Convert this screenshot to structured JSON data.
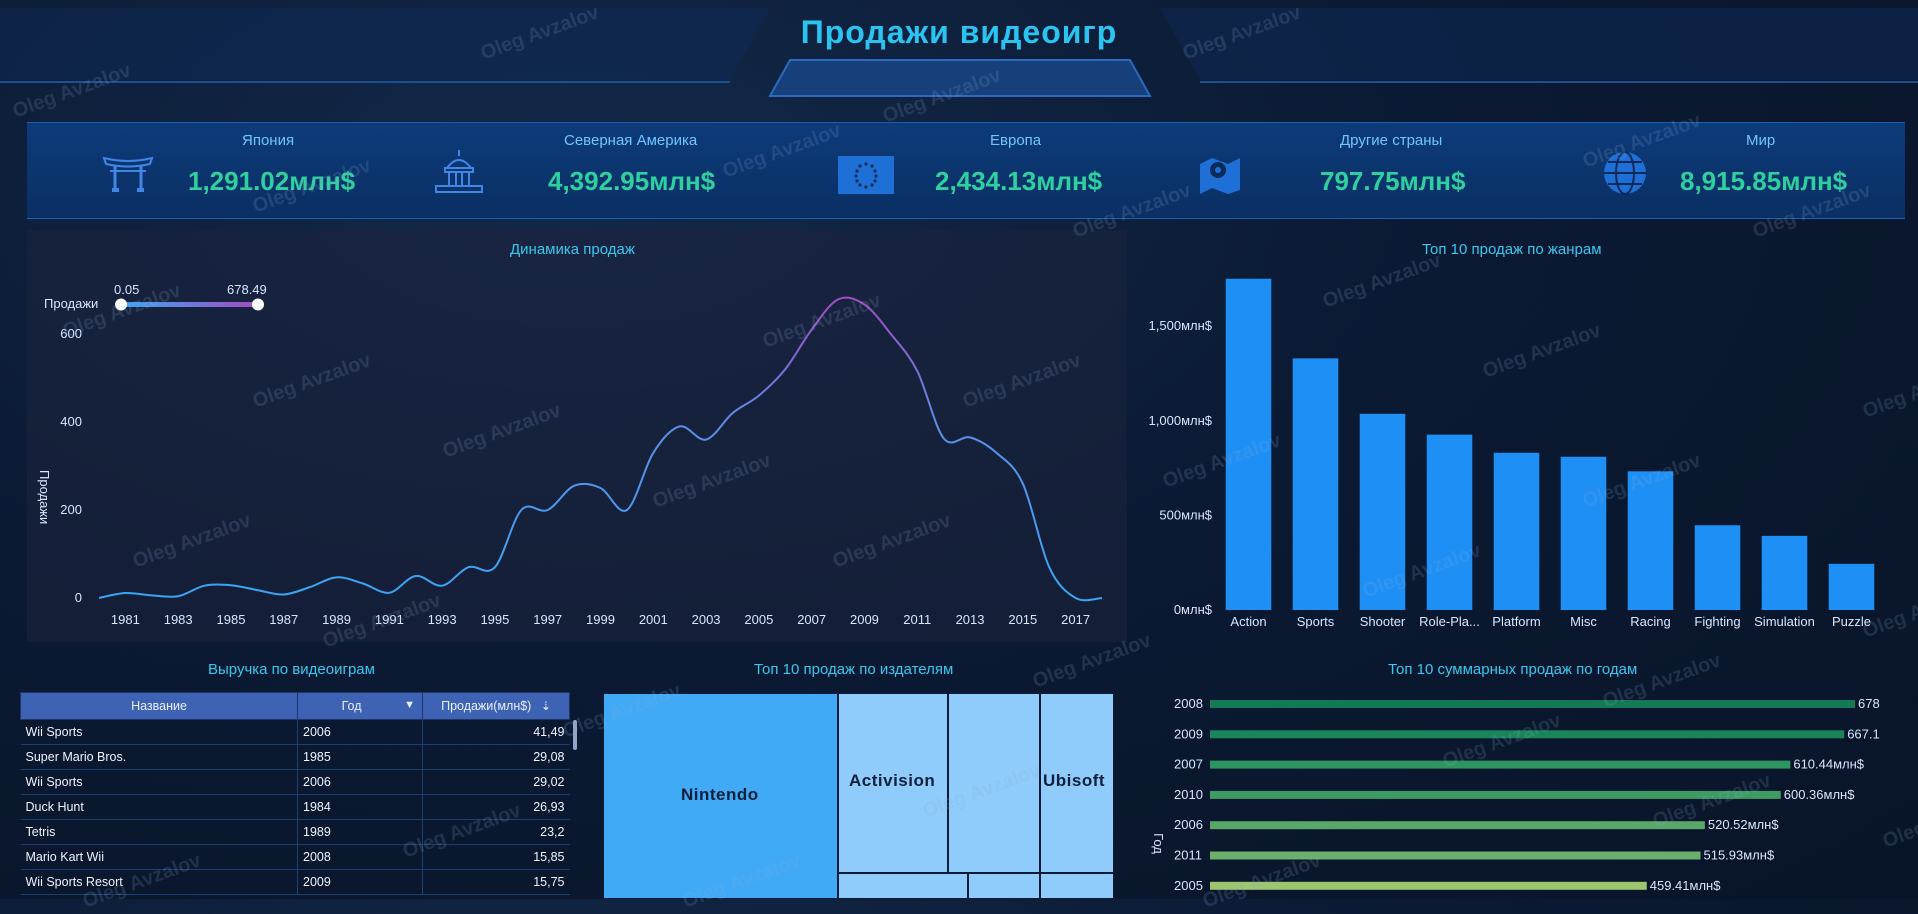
{
  "page_title": "Продажи видеоигр",
  "watermark": "Oleg Avzalov",
  "kpis": [
    {
      "label": "Япония",
      "value": "1,291.02млн$",
      "icon": "torii-gate-icon"
    },
    {
      "label": "Северная Америка",
      "value": "4,392.95млн$",
      "icon": "capitol-icon"
    },
    {
      "label": "Европа",
      "value": "2,434.13млн$",
      "icon": "eu-flag-icon"
    },
    {
      "label": "Другие страны",
      "value": "797.75млн$",
      "icon": "map-pin-icon"
    },
    {
      "label": "Мир",
      "value": "8,915.85млн$",
      "icon": "globe-icon"
    }
  ],
  "colors": {
    "accent": "#29c5f0",
    "kpi_value": "#2fd0a0",
    "bar": "#1e8ff5",
    "line_start": "#3aa6f5",
    "line_peak": "#a24cbf"
  },
  "chart_data": [
    {
      "type": "line",
      "title": "Динамика продаж",
      "ylabel": "Продажи",
      "legend_label": "Продажи",
      "range_min": "0.05",
      "range_max": "678.49",
      "x_ticks": [
        1981,
        1983,
        1985,
        1987,
        1989,
        1991,
        1993,
        1995,
        1997,
        1999,
        2001,
        2003,
        2005,
        2007,
        2009,
        2011,
        2013,
        2015,
        2017
      ],
      "y_ticks": [
        0,
        200,
        400,
        600
      ],
      "ylim": [
        0,
        700
      ],
      "x": [
        1980,
        1981,
        1982,
        1983,
        1984,
        1985,
        1986,
        1987,
        1988,
        1989,
        1990,
        1991,
        1992,
        1993,
        1994,
        1995,
        1996,
        1997,
        1998,
        1999,
        2000,
        2001,
        2002,
        2003,
        2004,
        2005,
        2006,
        2007,
        2008,
        2009,
        2010,
        2011,
        2012,
        2013,
        2014,
        2015,
        2016,
        2017,
        2018
      ],
      "values": [
        0.05,
        11.4,
        6,
        4,
        28,
        29,
        18,
        8,
        25,
        47,
        33,
        12,
        50,
        28,
        70,
        70,
        200,
        200,
        255,
        250,
        200,
        330,
        390,
        360,
        420,
        460,
        520,
        610,
        678.49,
        667,
        600,
        516,
        363,
        365,
        330,
        260,
        70,
        0.05,
        0.05
      ]
    },
    {
      "type": "bar",
      "title": "Топ 10 продаж по жанрам",
      "categories": [
        "Action",
        "Sports",
        "Shooter",
        "Role-Pla...",
        "Platform",
        "Misc",
        "Racing",
        "Fighting",
        "Simulation",
        "Puzzle"
      ],
      "values": [
        1751,
        1330,
        1037,
        927,
        831,
        810,
        733,
        448,
        392,
        244
      ],
      "y_ticks": [
        "0млн$",
        "500млн$",
        "1,000млн$",
        "1,500млн$"
      ],
      "y_tick_values": [
        0,
        500,
        1000,
        1500
      ],
      "ylim": [
        0,
        1850
      ]
    },
    {
      "type": "treemap",
      "title": "Топ 10 продаж по издателям",
      "labels": [
        "Nintendo",
        "Activision",
        "Ubisoft"
      ]
    },
    {
      "type": "bar",
      "orientation": "horizontal",
      "title": "Топ 10 суммарных продаж по годам",
      "ylabel": "Год",
      "categories": [
        "2008",
        "2009",
        "2007",
        "2010",
        "2006",
        "2011",
        "2005"
      ],
      "values": [
        678.49,
        667.1,
        610.44,
        600.36,
        520.52,
        515.93,
        459.41
      ],
      "value_labels": [
        "678.49млн$",
        "667.10млн$",
        "610.44млн$",
        "600.36млн$",
        "520.52млн$",
        "515.93млн$",
        "459.41млн$"
      ],
      "xlim": [
        0,
        710
      ]
    },
    {
      "type": "table",
      "title": "Выручка по видеоиграм",
      "columns": [
        "Название",
        "Год",
        "Продажи(млн$)"
      ],
      "rows": [
        [
          "Wii Sports",
          "2006",
          "41,49"
        ],
        [
          "Super Mario Bros.",
          "1985",
          "29,08"
        ],
        [
          "Wii Sports",
          "2006",
          "29,02"
        ],
        [
          "Duck Hunt",
          "1984",
          "26,93"
        ],
        [
          "Tetris",
          "1989",
          "23,2"
        ],
        [
          "Mario Kart Wii",
          "2008",
          "15,85"
        ],
        [
          "Wii Sports Resort",
          "2009",
          "15,75"
        ]
      ]
    }
  ]
}
